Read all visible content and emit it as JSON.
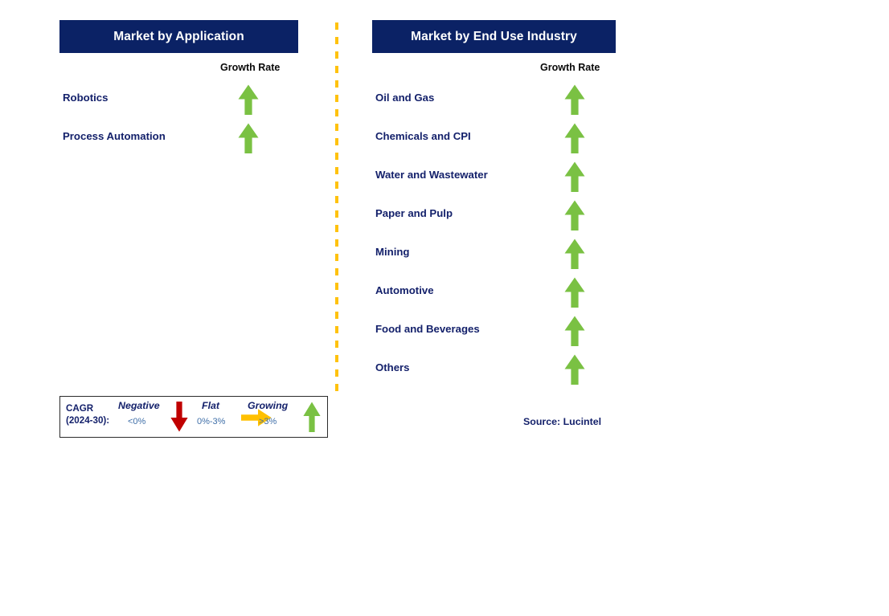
{
  "divider": {
    "color": "#FFC20E",
    "style": "dashed-vertical"
  },
  "colors": {
    "header_navy": "#0B2265",
    "label_navy": "#14216B",
    "growing_green": "#7AC143",
    "negative_red": "#C00000",
    "flat_orange": "#FFC000",
    "divider_orange": "#FFC20E"
  },
  "panels": [
    {
      "id": "application",
      "title": "Market by Application",
      "column_header": "Growth Rate",
      "items": [
        {
          "label": "Robotics",
          "growth": "growing",
          "icon": "arrow-up-icon"
        },
        {
          "label": "Process Automation",
          "growth": "growing",
          "icon": "arrow-up-icon"
        }
      ]
    },
    {
      "id": "enduse",
      "title": "Market by End Use Industry",
      "column_header": "Growth Rate",
      "items": [
        {
          "label": "Oil and Gas",
          "growth": "growing",
          "icon": "arrow-up-icon"
        },
        {
          "label": "Chemicals and CPI",
          "growth": "growing",
          "icon": "arrow-up-icon"
        },
        {
          "label": "Water and Wastewater",
          "growth": "growing",
          "icon": "arrow-up-icon"
        },
        {
          "label": "Paper and Pulp",
          "growth": "growing",
          "icon": "arrow-up-icon"
        },
        {
          "label": "Mining",
          "growth": "growing",
          "icon": "arrow-up-icon"
        },
        {
          "label": "Automotive",
          "growth": "growing",
          "icon": "arrow-up-icon"
        },
        {
          "label": "Food and Beverages",
          "growth": "growing",
          "icon": "arrow-up-icon"
        },
        {
          "label": "Others",
          "growth": "growing",
          "icon": "arrow-up-icon"
        }
      ]
    }
  ],
  "legend": {
    "cagr_line1": "CAGR",
    "cagr_line2": "(2024-30):",
    "entries": [
      {
        "title": "Negative",
        "range": "<0%",
        "icon": "arrow-down-icon",
        "color": "#C00000"
      },
      {
        "title": "Flat",
        "range": "0%-3%",
        "icon": "arrow-right-icon",
        "color": "#FFC000"
      },
      {
        "title": "Growing",
        "range": ">3%",
        "icon": "arrow-up-icon",
        "color": "#7AC143"
      }
    ]
  },
  "source": "Source: Lucintel"
}
